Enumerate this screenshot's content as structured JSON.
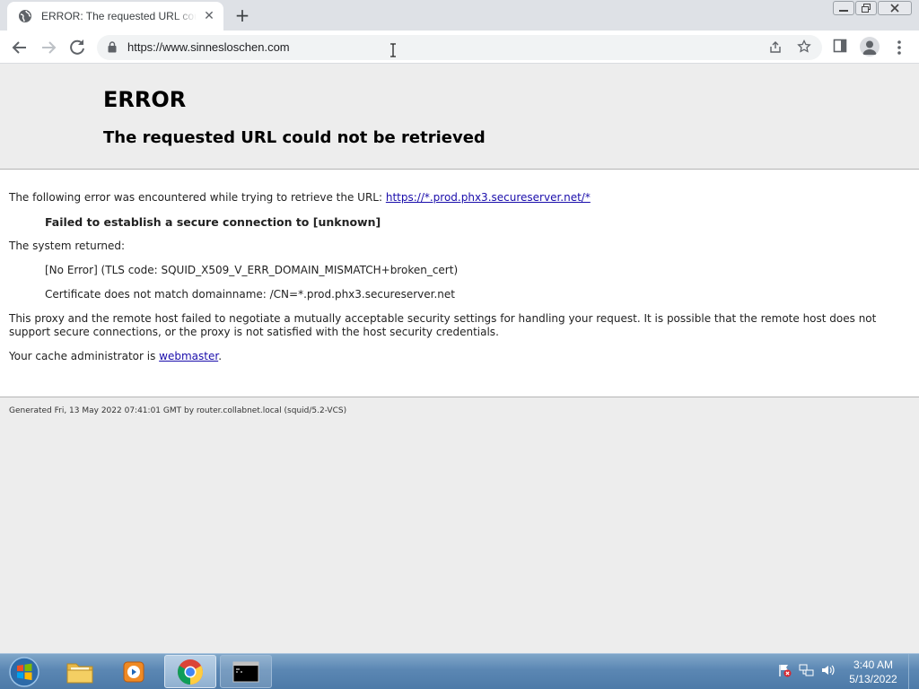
{
  "browser": {
    "tab_title": "ERROR: The requested URL could not be retrieved",
    "url": "https://www.sinnesloschen.com"
  },
  "page": {
    "title": "ERROR",
    "subtitle": "The requested URL could not be retrieved",
    "intro_text": "The following error was encountered while trying to retrieve the URL: ",
    "intro_link": "https://*.prod.phx3.secureserver.net/*",
    "error_headline": "Failed to establish a secure connection to [unknown]",
    "system_returned": "The system returned:",
    "tls_code": "[No Error] (TLS code: SQUID_X509_V_ERR_DOMAIN_MISMATCH+broken_cert)",
    "cert_mismatch": "Certificate does not match domainname: /CN=*.prod.phx3.secureserver.net",
    "proxy_paragraph": "This proxy and the remote host failed to negotiate a mutually acceptable security settings for handling your request. It is possible that the remote host does not support secure connections, or the proxy is not satisfied with the host security credentials.",
    "cache_admin_text": "Your cache administrator is ",
    "cache_admin_link": "webmaster",
    "cache_admin_suffix": ".",
    "footer": "Generated Fri, 13 May 2022 07:41:01 GMT by router.collabnet.local (squid/5.2-VCS)"
  },
  "taskbar": {
    "time": "3:40 AM",
    "date": "5/13/2022",
    "items": [
      "windows-explorer",
      "media-player",
      "google-chrome",
      "command-prompt"
    ]
  },
  "colors": {
    "link": "#1a0dab",
    "header_bg": "#ededed",
    "taskbar": "#5b87b3"
  }
}
